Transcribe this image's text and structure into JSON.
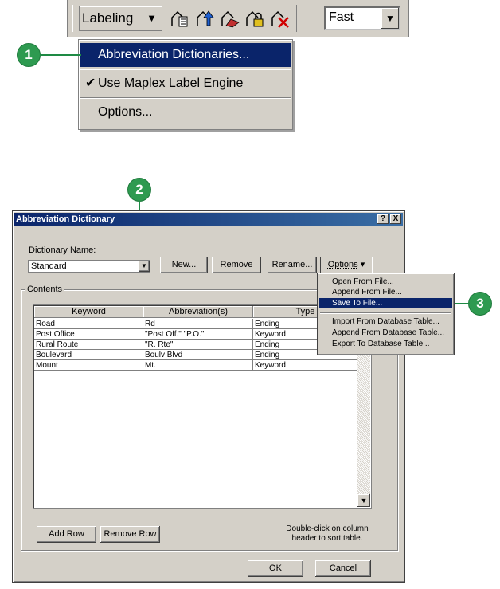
{
  "toolbar": {
    "labeling_label": "Labeling",
    "labeling_arrow": "▼",
    "quality_value": "Fast",
    "quality_arrow": "▼"
  },
  "labeling_menu": {
    "items": [
      {
        "label": "Abbreviation Dictionaries...",
        "checked": false,
        "highlighted": true
      },
      {
        "label": "Use Maplex Label Engine",
        "checked": true,
        "highlighted": false
      },
      {
        "label": "Options...",
        "checked": false,
        "highlighted": false
      }
    ],
    "check_glyph": "✔"
  },
  "callouts": {
    "one": "1",
    "two": "2",
    "three": "3"
  },
  "dialog": {
    "title": "Abbreviation Dictionary",
    "help_btn": "?",
    "close_btn": "X",
    "dictionary_name_label": "Dictionary Name:",
    "dictionary_name_value": "Standard",
    "combo_arrow": "▼",
    "new_button": "New...",
    "remove_button": "Remove",
    "rename_button": "Rename...",
    "options_button": "Options",
    "options_arrow": "▾",
    "contents_label": "Contents",
    "columns": [
      "Keyword",
      "Abbreviation(s)",
      "Type"
    ],
    "rows": [
      [
        "Road",
        "Rd",
        "Ending"
      ],
      [
        "Post Office",
        "\"Post Off.\" \"P.O.\"",
        "Keyword"
      ],
      [
        "Rural Route",
        "\"R. Rte\"",
        "Ending"
      ],
      [
        "Boulevard",
        "Boulv Blvd",
        "Ending"
      ],
      [
        "Mount",
        "Mt.",
        "Keyword"
      ]
    ],
    "scroll_down_glyph": "▼",
    "add_row_button": "Add Row",
    "remove_row_button": "Remove Row",
    "hint_line1": "Double-click on column",
    "hint_line2": "header to sort table.",
    "ok_button": "OK",
    "cancel_button": "Cancel"
  },
  "options_menu": {
    "items": [
      {
        "label": "Open From File...",
        "highlighted": false
      },
      {
        "label": "Append From File...",
        "highlighted": false
      },
      {
        "label": "Save To File...",
        "highlighted": true
      },
      {
        "label": "Import From Database Table...",
        "highlighted": false
      },
      {
        "label": "Append From Database Table...",
        "highlighted": false
      },
      {
        "label": "Export To Database Table...",
        "highlighted": false
      }
    ]
  },
  "colors": {
    "callout": "#2e9a50",
    "highlight": "#0a246a",
    "title_bar": "#0a246a"
  }
}
